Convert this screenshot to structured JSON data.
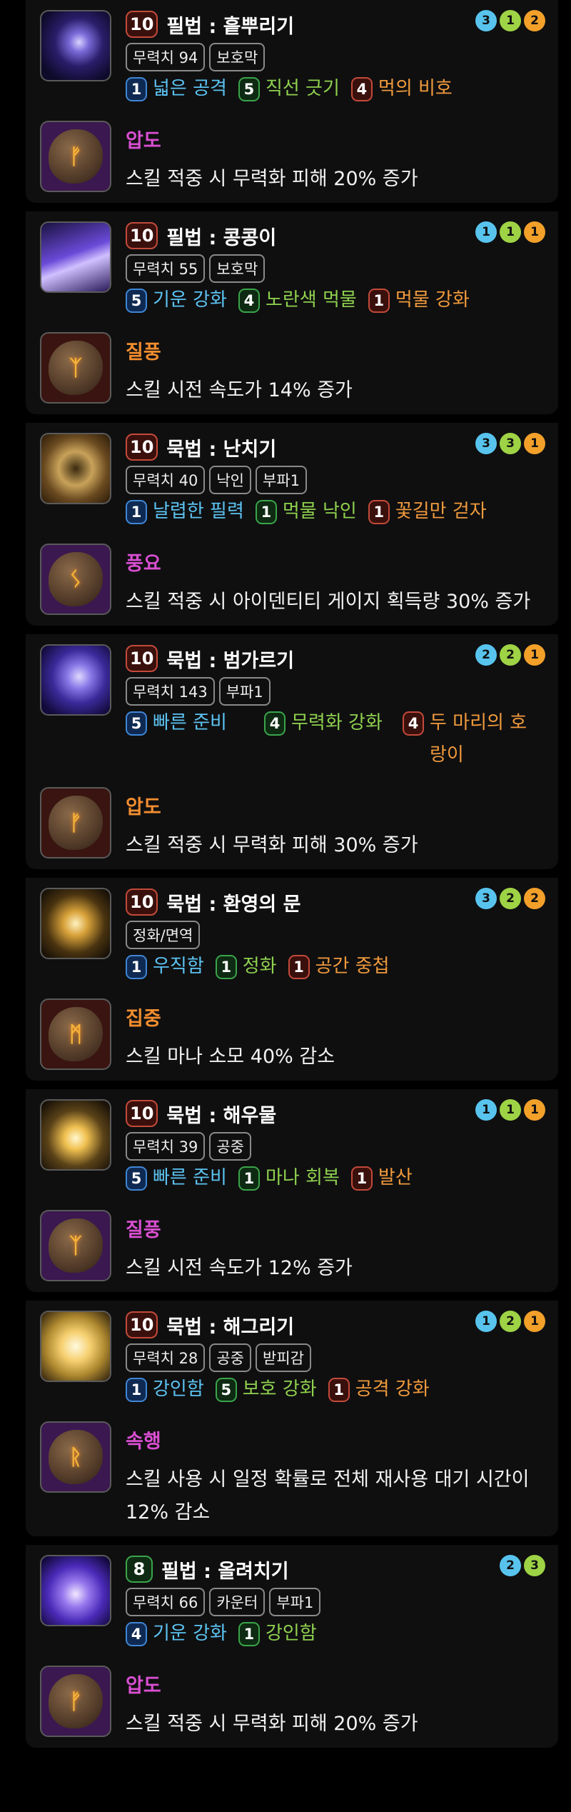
{
  "colors": {
    "background": "#000000",
    "card": "#0f0f10",
    "tripod_blue": "#5cc3f2",
    "tripod_green": "#8fd14e",
    "tripod_red": "#f09a3c",
    "rune_purple": "#d94fd1",
    "rune_orange": "#f28d2f"
  },
  "skills": [
    {
      "level": "10",
      "level_style": "red",
      "name": "필법 : 흩뿌리기",
      "dots": [
        [
          "3",
          "blue"
        ],
        [
          "1",
          "green"
        ],
        [
          "2",
          "orange"
        ]
      ],
      "tags": [
        "무력치 94",
        "보호막"
      ],
      "tripods": [
        [
          "1",
          "blue",
          "넓은 공격"
        ],
        [
          "5",
          "green",
          "직선 긋기"
        ],
        [
          "4",
          "red",
          "먹의 비호"
        ]
      ],
      "icon": "ink-splash-skill-icon",
      "rune": {
        "name": "압도",
        "color": "purple",
        "glyph": "ᚠ",
        "frame": "purple",
        "desc": "스킬 적중 시 무력화 피해 20% 증가"
      }
    },
    {
      "level": "10",
      "level_style": "red",
      "name": "필법 : 콩콩이",
      "dots": [
        [
          "1",
          "blue"
        ],
        [
          "1",
          "green"
        ],
        [
          "1",
          "orange"
        ]
      ],
      "tags": [
        "무력치 55",
        "보호막"
      ],
      "tripods": [
        [
          "5",
          "blue",
          "기운 강화"
        ],
        [
          "4",
          "green",
          "노란색 먹물"
        ],
        [
          "1",
          "red",
          "먹물 강화"
        ]
      ],
      "icon": "hopping-skill-icon",
      "rune": {
        "name": "질풍",
        "color": "orange",
        "glyph": "ᛉ",
        "frame": "red",
        "desc": "스킬 시전 속도가 14% 증가"
      }
    },
    {
      "level": "10",
      "level_style": "red",
      "name": "묵법 : 난치기",
      "dots": [
        [
          "3",
          "blue"
        ],
        [
          "3",
          "green"
        ],
        [
          "1",
          "orange"
        ]
      ],
      "tags": [
        "무력치 40",
        "낙인",
        "부파1"
      ],
      "tripods": [
        [
          "1",
          "blue",
          "날렵한 필력"
        ],
        [
          "1",
          "green",
          "먹물 낙인"
        ],
        [
          "1",
          "red",
          "꽃길만 걷자"
        ]
      ],
      "icon": "orchid-skill-icon",
      "rune": {
        "name": "풍요",
        "color": "purple",
        "glyph": "ᛊ",
        "frame": "purple",
        "desc": "스킬 적중 시 아이덴티티 게이지 획득량 30% 증가"
      }
    },
    {
      "level": "10",
      "level_style": "red",
      "name": "묵법 : 범가르기",
      "dots": [
        [
          "2",
          "blue"
        ],
        [
          "2",
          "green"
        ],
        [
          "1",
          "orange"
        ]
      ],
      "tags": [
        "무력치 143",
        "부파1"
      ],
      "tripods": [
        [
          "5",
          "blue",
          "빠른 준비"
        ],
        [
          "4",
          "green",
          "무력화 강화"
        ],
        [
          "4",
          "red",
          "두 마리의 호랑이"
        ]
      ],
      "wrap": true,
      "icon": "tiger-skill-icon",
      "rune": {
        "name": "압도",
        "color": "orange",
        "glyph": "ᚠ",
        "frame": "red",
        "desc": "스킬 적중 시 무력화 피해 30% 증가"
      }
    },
    {
      "level": "10",
      "level_style": "red",
      "name": "묵법 : 환영의 문",
      "dots": [
        [
          "3",
          "blue"
        ],
        [
          "2",
          "green"
        ],
        [
          "2",
          "orange"
        ]
      ],
      "tags": [
        "정화/면역"
      ],
      "tripods": [
        [
          "1",
          "blue",
          "우직함"
        ],
        [
          "1",
          "green",
          "정화"
        ],
        [
          "1",
          "red",
          "공간 중첩"
        ]
      ],
      "icon": "phantom-gate-skill-icon",
      "rune": {
        "name": "집중",
        "color": "orange",
        "glyph": "ᛗ",
        "frame": "red",
        "desc": "스킬 마나 소모 40% 감소"
      }
    },
    {
      "level": "10",
      "level_style": "red",
      "name": "묵법 : 해우물",
      "dots": [
        [
          "1",
          "blue"
        ],
        [
          "1",
          "green"
        ],
        [
          "1",
          "orange"
        ]
      ],
      "tags": [
        "무력치 39",
        "공중"
      ],
      "tripods": [
        [
          "5",
          "blue",
          "빠른 준비"
        ],
        [
          "1",
          "green",
          "마나 회복"
        ],
        [
          "1",
          "red",
          "발산"
        ]
      ],
      "icon": "sun-well-skill-icon",
      "rune": {
        "name": "질풍",
        "color": "purple",
        "glyph": "ᛉ",
        "frame": "purple",
        "desc": "스킬 시전 속도가 12% 증가"
      }
    },
    {
      "level": "10",
      "level_style": "red",
      "name": "묵법 : 해그리기",
      "dots": [
        [
          "1",
          "blue"
        ],
        [
          "2",
          "green"
        ],
        [
          "1",
          "orange"
        ]
      ],
      "tags": [
        "무력치 28",
        "공중",
        "받피감"
      ],
      "tripods": [
        [
          "1",
          "blue",
          "강인함"
        ],
        [
          "5",
          "green",
          "보호 강화"
        ],
        [
          "1",
          "red",
          "공격 강화"
        ]
      ],
      "icon": "sun-draw-skill-icon",
      "rune": {
        "name": "속행",
        "color": "purple",
        "glyph": "ᚱ",
        "frame": "purple",
        "desc": "스킬 사용 시 일정 확률로 전체 재사용 대기 시간이 12% 감소"
      }
    },
    {
      "level": "8",
      "level_style": "green",
      "name": "필법 : 올려치기",
      "dots": [
        [
          "2",
          "blue"
        ],
        [
          "3",
          "green"
        ]
      ],
      "tags": [
        "무력치 66",
        "카운터",
        "부파1"
      ],
      "tripods": [
        [
          "4",
          "blue",
          "기운 강화"
        ],
        [
          "1",
          "green",
          "강인함"
        ]
      ],
      "icon": "upswing-skill-icon",
      "rune": {
        "name": "압도",
        "color": "purple",
        "glyph": "ᚠ",
        "frame": "purple",
        "desc": "스킬 적중 시 무력화 피해 20% 증가"
      }
    }
  ]
}
